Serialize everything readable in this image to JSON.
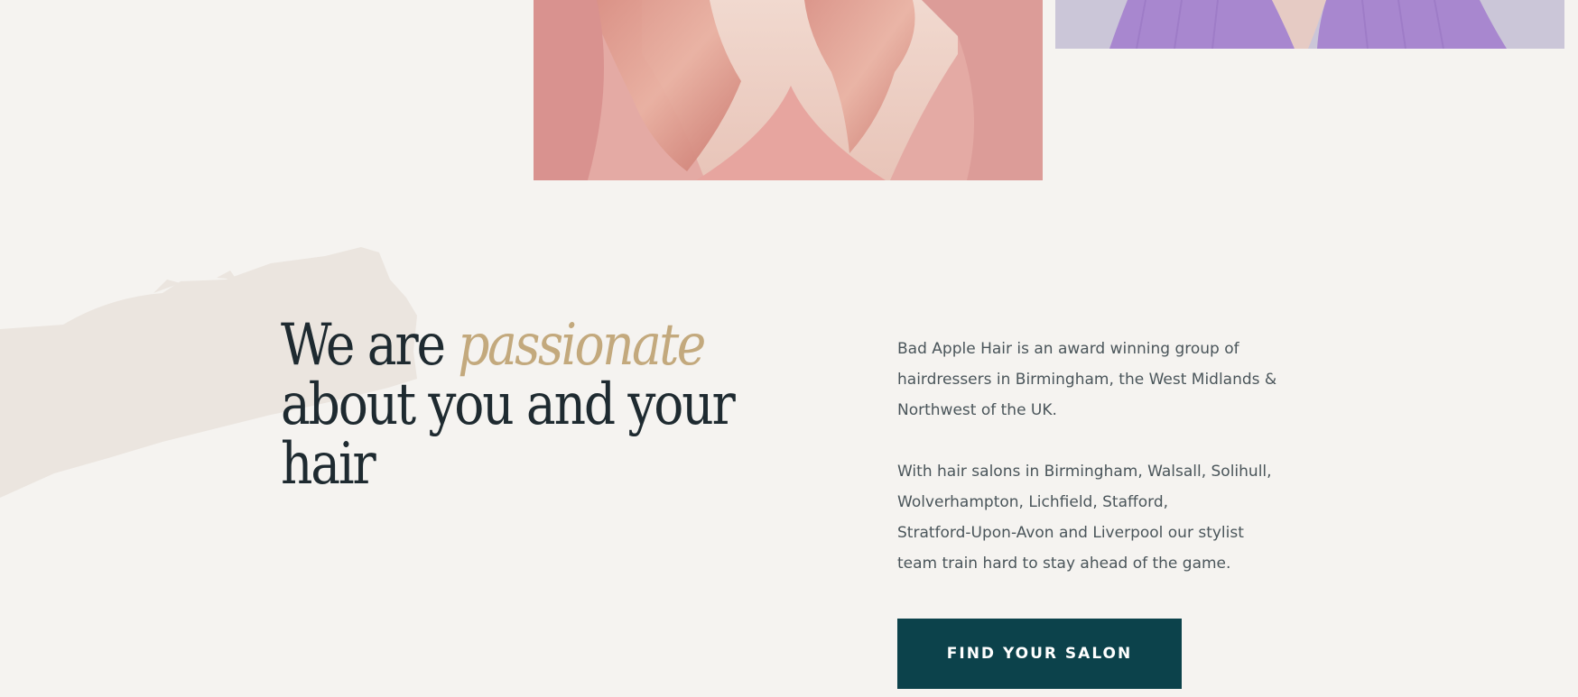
{
  "photos": {
    "left_icon": "model-pink-hair-photo",
    "right_icon": "model-purple-top-photo"
  },
  "headline": {
    "before": "We are ",
    "accent": "passionate",
    "after": " about you and your hair"
  },
  "intro": {
    "paragraph_1": "Bad Apple Hair is an award winning group of\nhairdressers in Birmingham, the West Midlands &\nNorthwest of the UK.",
    "paragraph_2": "With hair salons in Birmingham, Walsall, Solihull,\nWolverhampton, Lichfield, Stafford,\nStratford-Upon-Avon and Liverpool our stylist\nteam train hard to stay ahead of the game."
  },
  "cta": {
    "label": "FIND YOUR SALON"
  },
  "colors": {
    "background": "#f5f3f0",
    "heading": "#1e2a30",
    "accent_gold": "#c3a97d",
    "body_text": "#4a555a",
    "button_bg": "#0c424b",
    "button_text": "#ffffff",
    "brush": "#ebe5df"
  }
}
